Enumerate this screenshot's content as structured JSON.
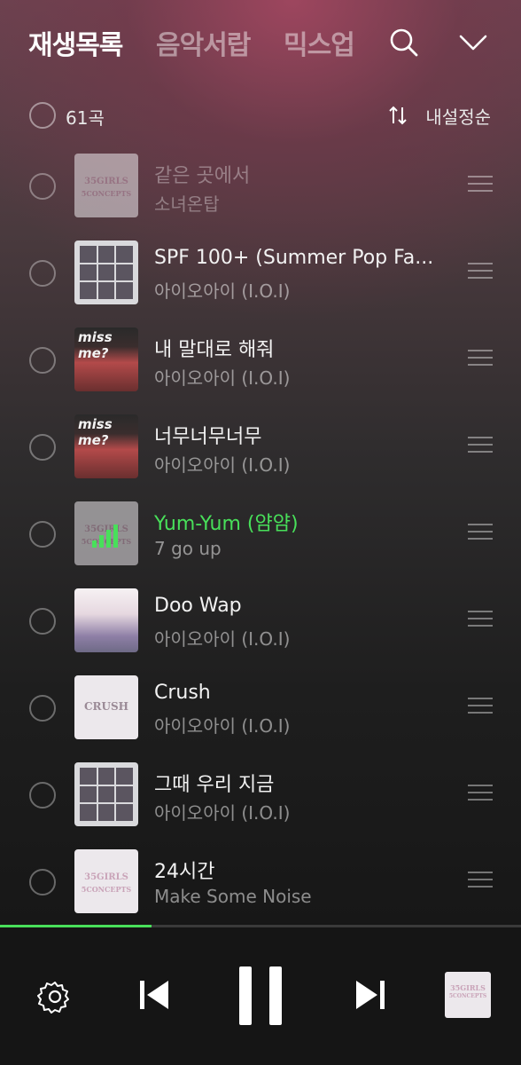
{
  "header": {
    "tabs": [
      {
        "label": "재생목록",
        "active": true
      },
      {
        "label": "음악서랍",
        "active": false
      },
      {
        "label": "믹스업",
        "active": false
      }
    ],
    "icons": {
      "search": "search-icon",
      "collapse": "chevron-down-icon"
    }
  },
  "sortbar": {
    "count_label": "61곡",
    "sort_label": "내설정순",
    "sort_icon": "sort-arrows-icon"
  },
  "playlist": [
    {
      "title": "같은 곳에서",
      "artist": "소녀온탑",
      "art": "35girls",
      "state": "dim"
    },
    {
      "title": "SPF 100+ (Summer Pop Fa...",
      "artist": "아이오아이 (I.O.I)",
      "art": "grid",
      "state": "normal"
    },
    {
      "title": "내 말대로 해줘",
      "artist": "아이오아이 (I.O.I)",
      "art": "miss",
      "state": "normal"
    },
    {
      "title": "너무너무너무",
      "artist": "아이오아이 (I.O.I)",
      "art": "miss",
      "state": "normal"
    },
    {
      "title": "Yum-Yum (얌얌)",
      "artist": "7 go up",
      "art": "35girls",
      "state": "playing"
    },
    {
      "title": "Doo Wap",
      "artist": "아이오아이 (I.O.I)",
      "art": "doo",
      "state": "normal"
    },
    {
      "title": "Crush",
      "artist": "아이오아이 (I.O.I)",
      "art": "crush",
      "state": "normal"
    },
    {
      "title": "그때 우리 지금",
      "artist": "아이오아이 (I.O.I)",
      "art": "grid",
      "state": "normal"
    },
    {
      "title": "24시간",
      "artist": "Make Some Noise",
      "art": "35girls",
      "state": "normal"
    }
  ],
  "art_labels": {
    "35girls_line1": "35GIRLS",
    "35girls_line2": "5CONCEPTS",
    "miss": "miss me?",
    "crush": "CRUSH"
  },
  "player": {
    "progress": 0.29,
    "accent_color": "#48e05a",
    "icons": [
      "settings-icon",
      "previous-icon",
      "pause-icon",
      "next-icon"
    ]
  }
}
